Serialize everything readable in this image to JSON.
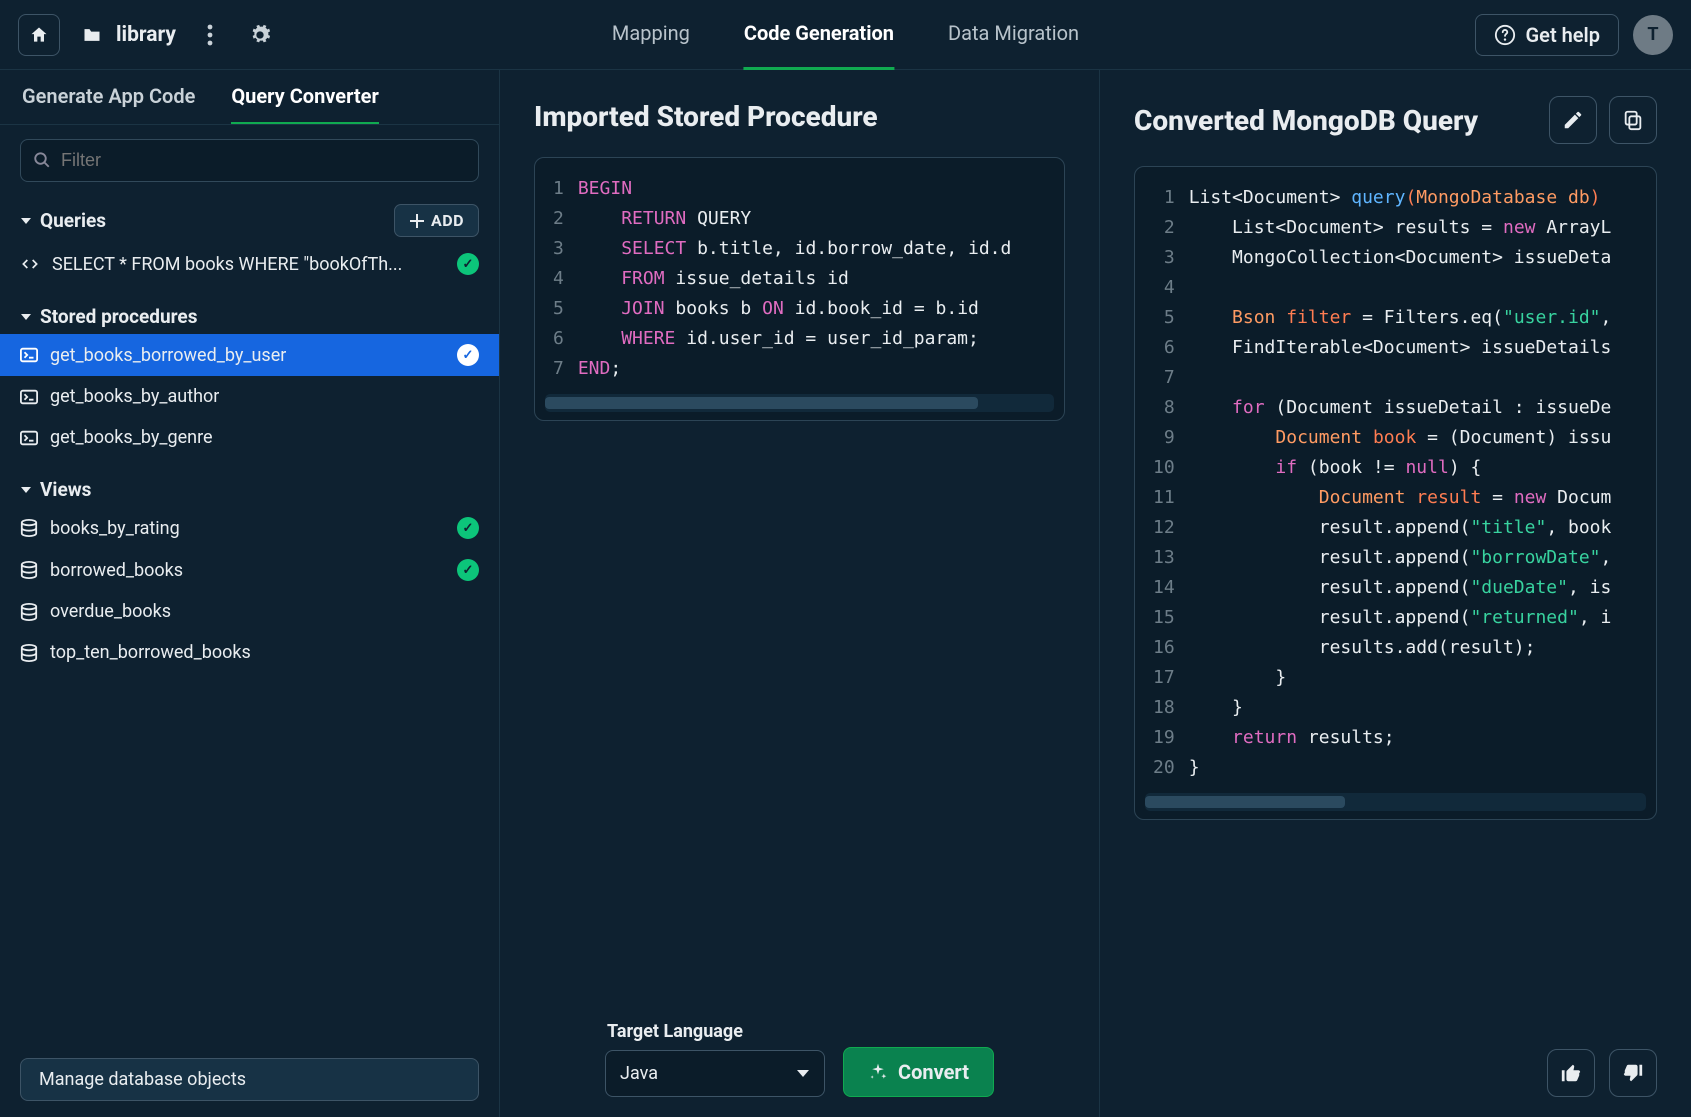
{
  "header": {
    "project_name": "library",
    "nav": {
      "mapping": "Mapping",
      "codegen": "Code Generation",
      "migration": "Data Migration"
    },
    "help_label": "Get help",
    "avatar_initial": "T"
  },
  "sidebar": {
    "tabs": {
      "app_code": "Generate App Code",
      "query_conv": "Query Converter"
    },
    "filter_placeholder": "Filter",
    "queries_label": "Queries",
    "add_label": "ADD",
    "query_item": "SELECT * FROM books WHERE \"bookOfTh...",
    "sp_label": "Stored procedures",
    "sp_items": {
      "0": "get_books_borrowed_by_user",
      "1": "get_books_by_author",
      "2": "get_books_by_genre"
    },
    "views_label": "Views",
    "view_items": {
      "0": "books_by_rating",
      "1": "borrowed_books",
      "2": "overdue_books",
      "3": "top_ten_borrowed_books"
    },
    "manage_label": "Manage database objects"
  },
  "center": {
    "title": "Imported Stored Procedure",
    "lines": {
      "1": "1",
      "2": "2",
      "3": "3",
      "4": "4",
      "5": "5",
      "6": "6",
      "7": "7"
    },
    "code": {
      "l1a": "BEGIN",
      "l2a": "RETURN",
      "l2b": " QUERY",
      "l3a": "SELECT",
      "l3b": " b.title, id.borrow_date, id.d",
      "l4a": "FROM",
      "l4b": " issue_details id",
      "l5a": "JOIN",
      "l5b": " books b ",
      "l5c": "ON",
      "l5d": " id.book_id = b.id",
      "l6a": "WHERE",
      "l6b": " id.user_id = user_id_param;",
      "l7a": "END",
      "l7b": ";"
    },
    "target_label": "Target Language",
    "target_value": "Java",
    "convert_label": "Convert"
  },
  "right": {
    "title": "Converted MongoDB Query",
    "lines": {
      "1": "1",
      "2": "2",
      "3": "3",
      "4": "4",
      "5": "5",
      "6": "6",
      "7": "7",
      "8": "8",
      "9": "9",
      "10": "10",
      "11": "11",
      "12": "12",
      "13": "13",
      "14": "14",
      "15": "15",
      "16": "16",
      "17": "17",
      "18": "18",
      "19": "19",
      "20": "20"
    },
    "code": {
      "l1a": "List<Document> ",
      "l1b": "query",
      "l1c": "(",
      "l1d": "MongoDatabase db",
      "l1e": ")",
      "l2a": "List<Document> results = ",
      "l2b": "new",
      "l2c": " ArrayL",
      "l3a": "MongoCollection<Document> issueDeta",
      "l5a": "Bson ",
      "l5b": "filter",
      "l5c": " = Filters.eq(",
      "l5d": "\"user.id\"",
      "l5e": ",",
      "l6a": "FindIterable<Document> issueDetails",
      "l8a": "for",
      "l8b": " (Document issueDetail : issueDe",
      "l9a": "Document ",
      "l9b": "book",
      "l9c": " = (Document) issu",
      "l10a": "if",
      "l10b": " (book != ",
      "l10c": "null",
      "l10d": ") {",
      "l11a": "Document ",
      "l11b": "result",
      "l11c": " = ",
      "l11d": "new",
      "l11e": " Docum",
      "l12a": "result.append(",
      "l12b": "\"title\"",
      "l12c": ", book",
      "l13a": "result.append(",
      "l13b": "\"borrowDate\"",
      "l13c": ",",
      "l14a": "result.append(",
      "l14b": "\"dueDate\"",
      "l14c": ", is",
      "l15a": "result.append(",
      "l15b": "\"returned\"",
      "l15c": ", i",
      "l16a": "results.add(result);",
      "l17a": "}",
      "l18a": "}",
      "l19a": "return",
      "l19b": " results;",
      "l20a": "}"
    }
  }
}
